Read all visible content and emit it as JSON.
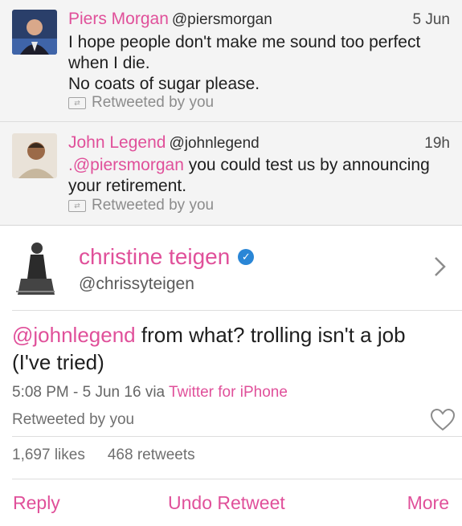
{
  "tweets": [
    {
      "name": "Piers Morgan",
      "handle": "@piersmorgan",
      "time": "5 Jun",
      "line1": "I hope people don't make me sound too perfect",
      "line2": "when I die.",
      "line3": "No coats of sugar please.",
      "retweeted": "Retweeted by you"
    },
    {
      "name": "John Legend",
      "handle": "@johnlegend",
      "time": "19h",
      "mention": ".@piersmorgan",
      "line1_rest": " you could test us by announcing",
      "line2": "your retirement.",
      "retweeted": "Retweeted by you"
    }
  ],
  "main": {
    "name": "christine teigen",
    "handle": "@chrissyteigen",
    "mention": "@johnlegend",
    "text_rest": " from what? trolling isn't a job (I've tried)",
    "meta_time": "5:08 PM - 5 Jun 16 via ",
    "meta_source": "Twitter for iPhone",
    "retweeted": "Retweeted by you",
    "likes": "1,697 likes",
    "retweets": "468 retweets"
  },
  "actions": {
    "reply": "Reply",
    "undo": "Undo Retweet",
    "more": "More"
  },
  "colors": {
    "accent": "#e0509a",
    "verified": "#2a86d6",
    "row_bg": "#f4f4f4"
  }
}
